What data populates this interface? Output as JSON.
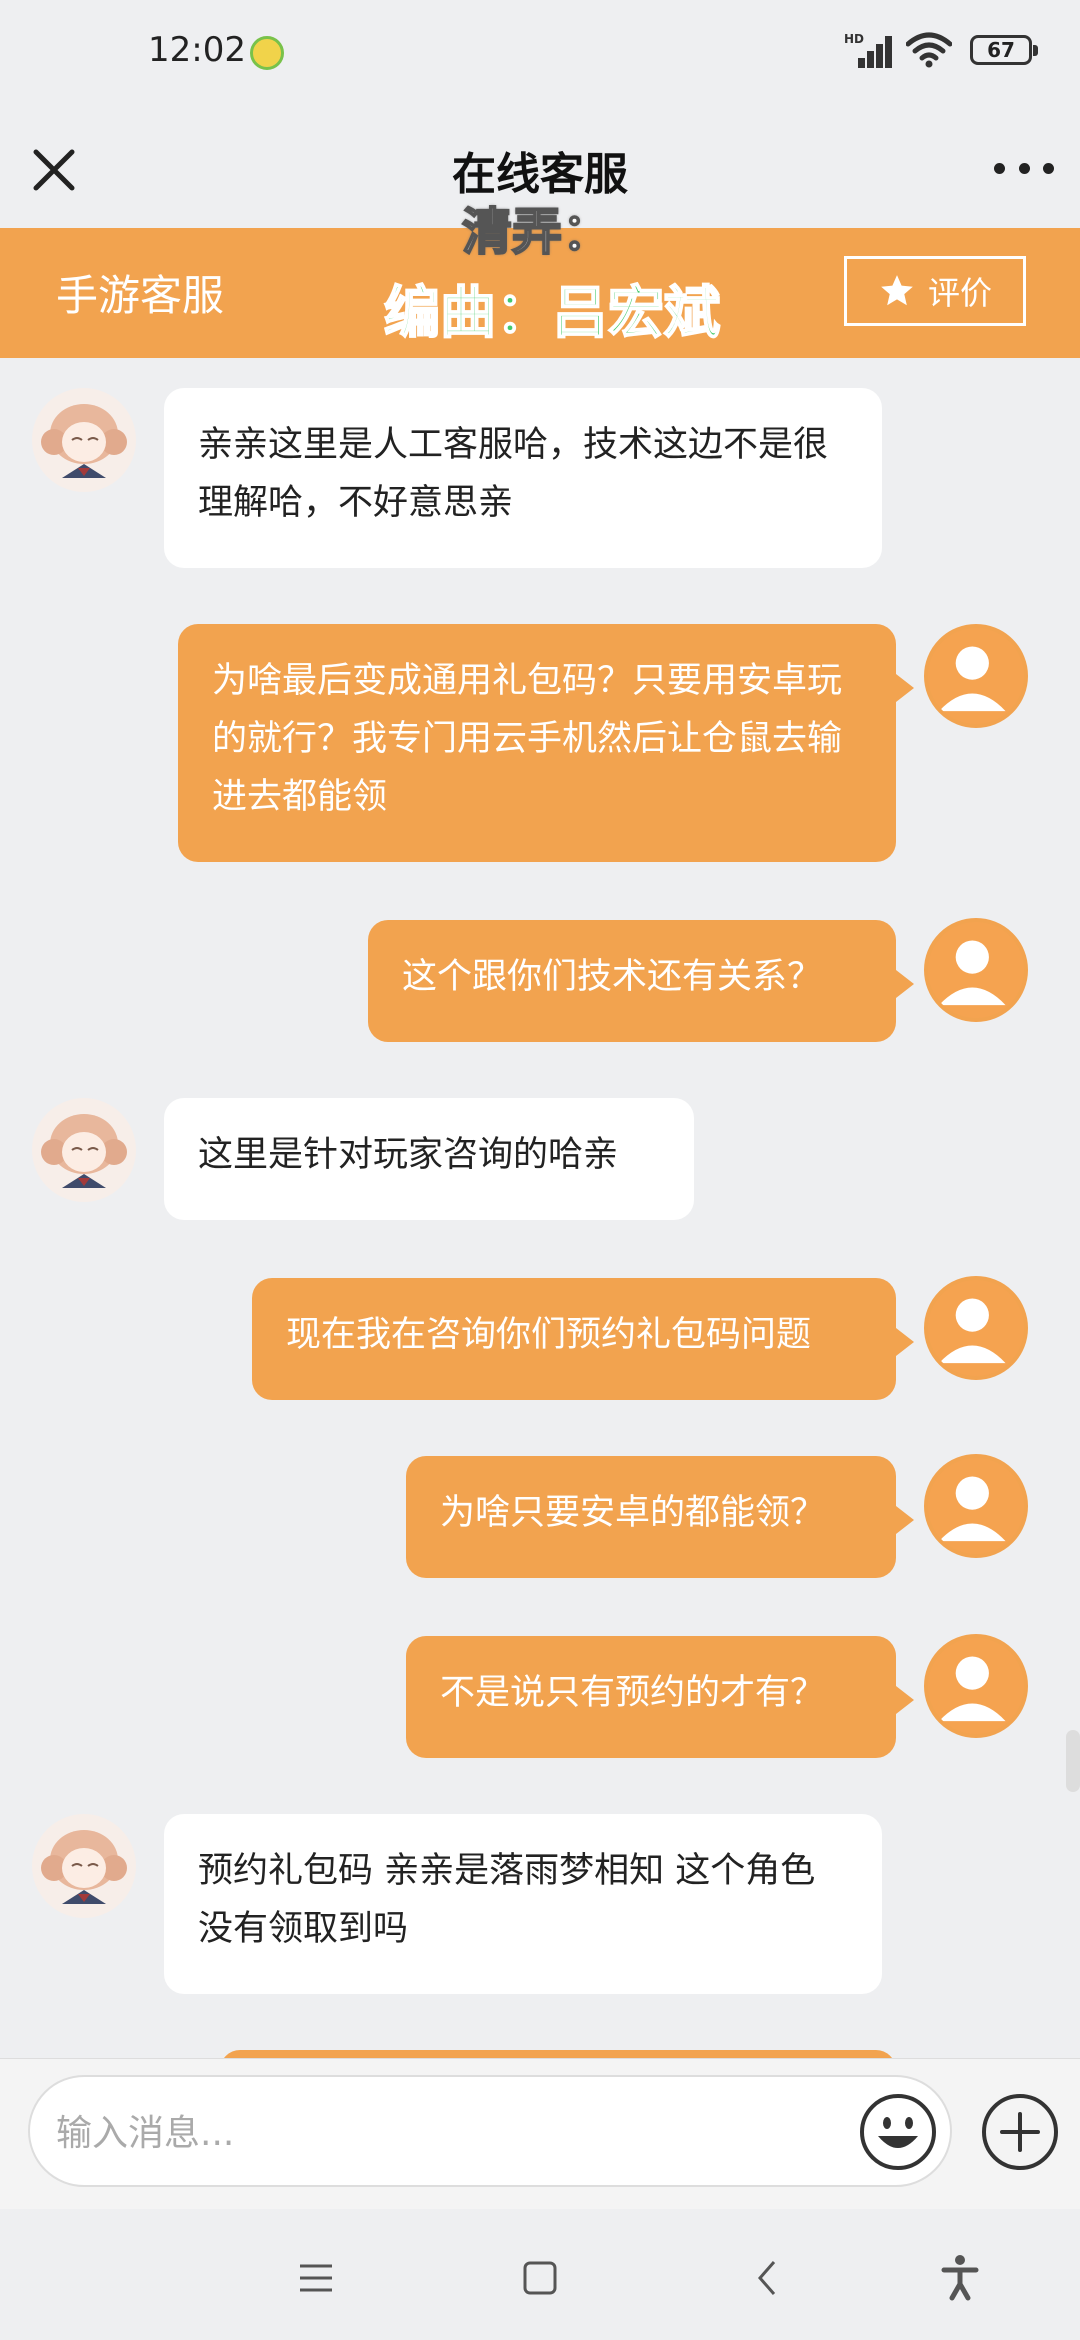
{
  "status_bar": {
    "time": "12:02",
    "battery": "67"
  },
  "nav": {
    "title": "在线客服"
  },
  "header": {
    "service_name": "手游客服",
    "rate_label": "评价"
  },
  "overlay": {
    "line1": "清弄：",
    "line2": "编曲：吕宏斌"
  },
  "messages": [
    {
      "side": "in",
      "text": "亲亲这里是人工客服哈，技术这边不是很理解哈，不好意思亲"
    },
    {
      "side": "out",
      "text": "为啥最后变成通用礼包码？只要用安卓玩的就行？我专门用云手机然后让仓鼠去输进去都能领"
    },
    {
      "side": "out",
      "text": "这个跟你们技术还有关系？"
    },
    {
      "side": "in",
      "text": "这里是针对玩家咨询的哈亲"
    },
    {
      "side": "out",
      "text": "现在我在咨询你们预约礼包码问题"
    },
    {
      "side": "out",
      "text": "为啥只要安卓的都能领？"
    },
    {
      "side": "out",
      "text": "不是说只有预约的才有？"
    },
    {
      "side": "in",
      "text": "预约礼包码  亲亲是落雨梦相知  这个角色没有领取到吗"
    }
  ],
  "input": {
    "placeholder": "输入消息..."
  },
  "colors": {
    "accent": "#F2A34F",
    "background": "#EEEFF1"
  }
}
